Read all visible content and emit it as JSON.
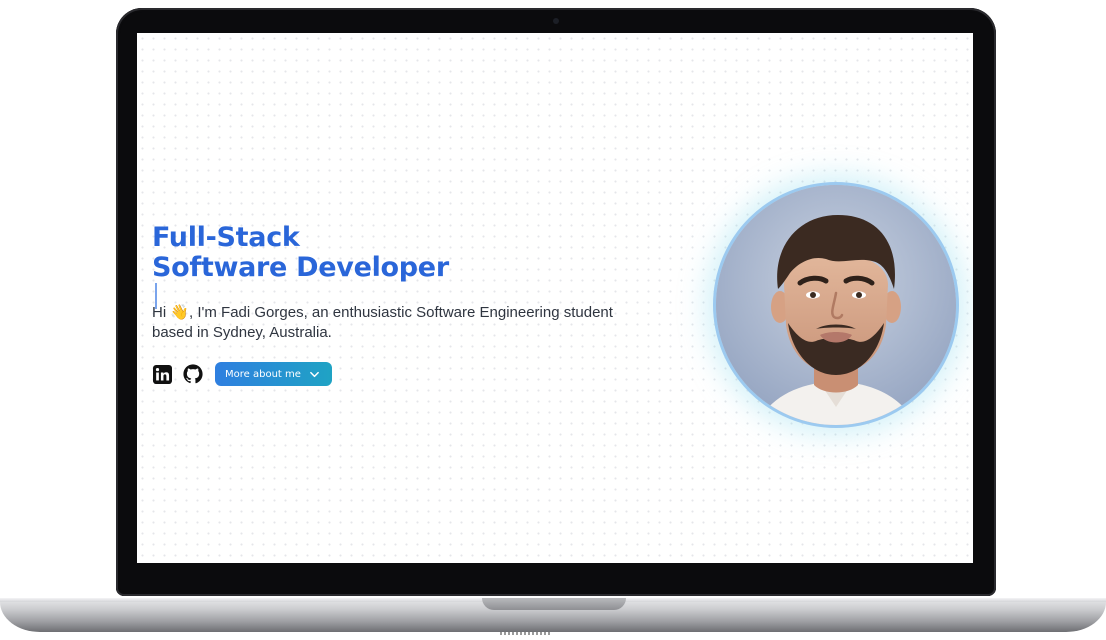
{
  "hero": {
    "title_line1": "Full-Stack",
    "title_line2": "Software Developer",
    "intro": "Hi 👋, I'm Fadi Gorges, an enthusiastic Software Engineering student based in Sydney, Australia."
  },
  "socials": {
    "linkedin_icon": "linkedin-icon",
    "github_icon": "github-icon"
  },
  "cta": {
    "label": "More about me",
    "icon": "chevron-down-icon"
  },
  "colors": {
    "accent": "#2a66d9",
    "button_gradient_start": "#2f7fe0",
    "button_gradient_end": "#1fa3c4",
    "body_text": "#2f3540"
  }
}
